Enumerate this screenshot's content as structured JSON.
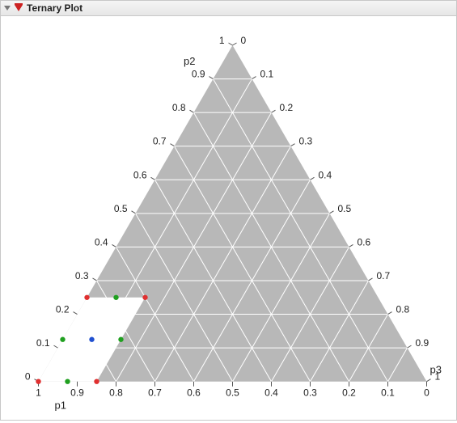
{
  "header": {
    "title": "Ternary Plot"
  },
  "chart_data": {
    "type": "ternary",
    "axes": [
      {
        "name": "p1",
        "label": "p1"
      },
      {
        "name": "p2",
        "label": "p2"
      },
      {
        "name": "p3",
        "label": "p3"
      }
    ],
    "ticks": [
      "0",
      "0.1",
      "0.2",
      "0.3",
      "0.4",
      "0.5",
      "0.6",
      "0.7",
      "0.8",
      "0.9",
      "1"
    ],
    "points": [
      {
        "p1": 0.75,
        "p2": 0.25,
        "p3": 0.0,
        "group": "vertex",
        "color": "#e03030"
      },
      {
        "p1": 0.6,
        "p2": 0.25,
        "p3": 0.15,
        "group": "vertex",
        "color": "#e03030"
      },
      {
        "p1": 0.85,
        "p2": 0.0,
        "p3": 0.15,
        "group": "vertex",
        "color": "#e03030"
      },
      {
        "p1": 1.0,
        "p2": 0.0,
        "p3": 0.0,
        "group": "vertex",
        "color": "#e03030"
      },
      {
        "p1": 0.675,
        "p2": 0.25,
        "p3": 0.075,
        "group": "edge",
        "color": "#20a020"
      },
      {
        "p1": 0.725,
        "p2": 0.125,
        "p3": 0.15,
        "group": "edge",
        "color": "#20a020"
      },
      {
        "p1": 0.925,
        "p2": 0.0,
        "p3": 0.075,
        "group": "edge",
        "color": "#20a020"
      },
      {
        "p1": 0.875,
        "p2": 0.125,
        "p3": 0.0,
        "group": "edge",
        "color": "#20a020"
      },
      {
        "p1": 0.8,
        "p2": 0.125,
        "p3": 0.075,
        "group": "center",
        "color": "#2050d0"
      }
    ],
    "design_region": [
      {
        "p1": 1.0,
        "p2": 0.0,
        "p3": 0.0
      },
      {
        "p1": 0.75,
        "p2": 0.25,
        "p3": 0.0
      },
      {
        "p1": 0.6,
        "p2": 0.25,
        "p3": 0.15
      },
      {
        "p1": 0.85,
        "p2": 0.0,
        "p3": 0.15
      }
    ],
    "grid_step": 0.1
  }
}
